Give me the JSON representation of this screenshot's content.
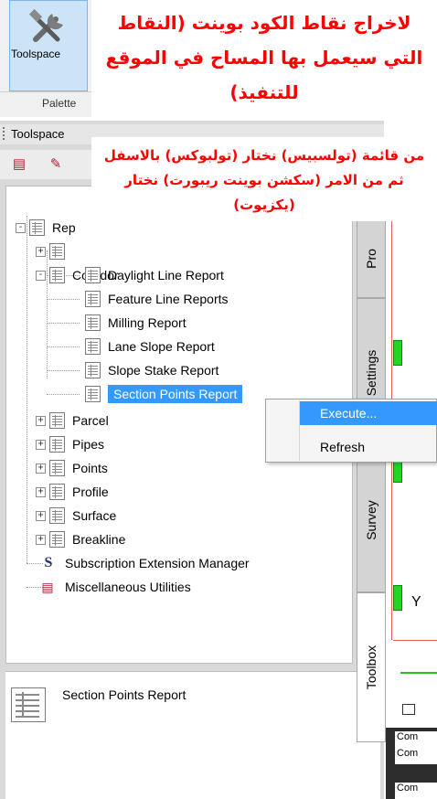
{
  "ribbon": {
    "tool_label": "Toolspace",
    "palette_label": "Palette"
  },
  "toolspace": {
    "title": "Toolspace"
  },
  "tree": {
    "root_label": "Rep",
    "corridor_label": "Corridor",
    "corridor_items": [
      "Daylight Line Report",
      "Feature Line Reports",
      "Milling Report",
      "Lane Slope Report",
      "Slope Stake Report",
      "Section Points Report"
    ],
    "groups": [
      "Parcel",
      "Pipes",
      "Points",
      "Profile",
      "Surface",
      "Breakline"
    ],
    "subscription_label": "Subscription Extension Manager",
    "misc_label": "Miscellaneous Utilities"
  },
  "context_menu": {
    "execute": "Execute...",
    "refresh": "Refresh"
  },
  "tabs": {
    "pro": "Pro",
    "settings": "Settings",
    "survey": "Survey",
    "toolbox": "Toolbox"
  },
  "description": {
    "text": "Section Points Report"
  },
  "command_line": {
    "line1": "Com",
    "line2": "Com",
    "line3": "Com"
  },
  "drawing": {
    "axis_label": "Y"
  },
  "overlay": {
    "title_lines": [
      "لاخراج نقاط الكود بوينت (النقاط",
      "التي سيعمل بها المساح في الموقع",
      "للتنفيذ)"
    ],
    "subtitle_lines": [
      "من قائمة (تولسبيس) نختار (تولبوكس) بالاسفل",
      "ثم من الامر (سكشن بوينت ريبورت) نختار",
      "(يكزيوت)"
    ]
  },
  "colors": {
    "overlay_text": "#ff0000",
    "selection": "#3399ff",
    "ribbon_button": "#cce4f7"
  }
}
